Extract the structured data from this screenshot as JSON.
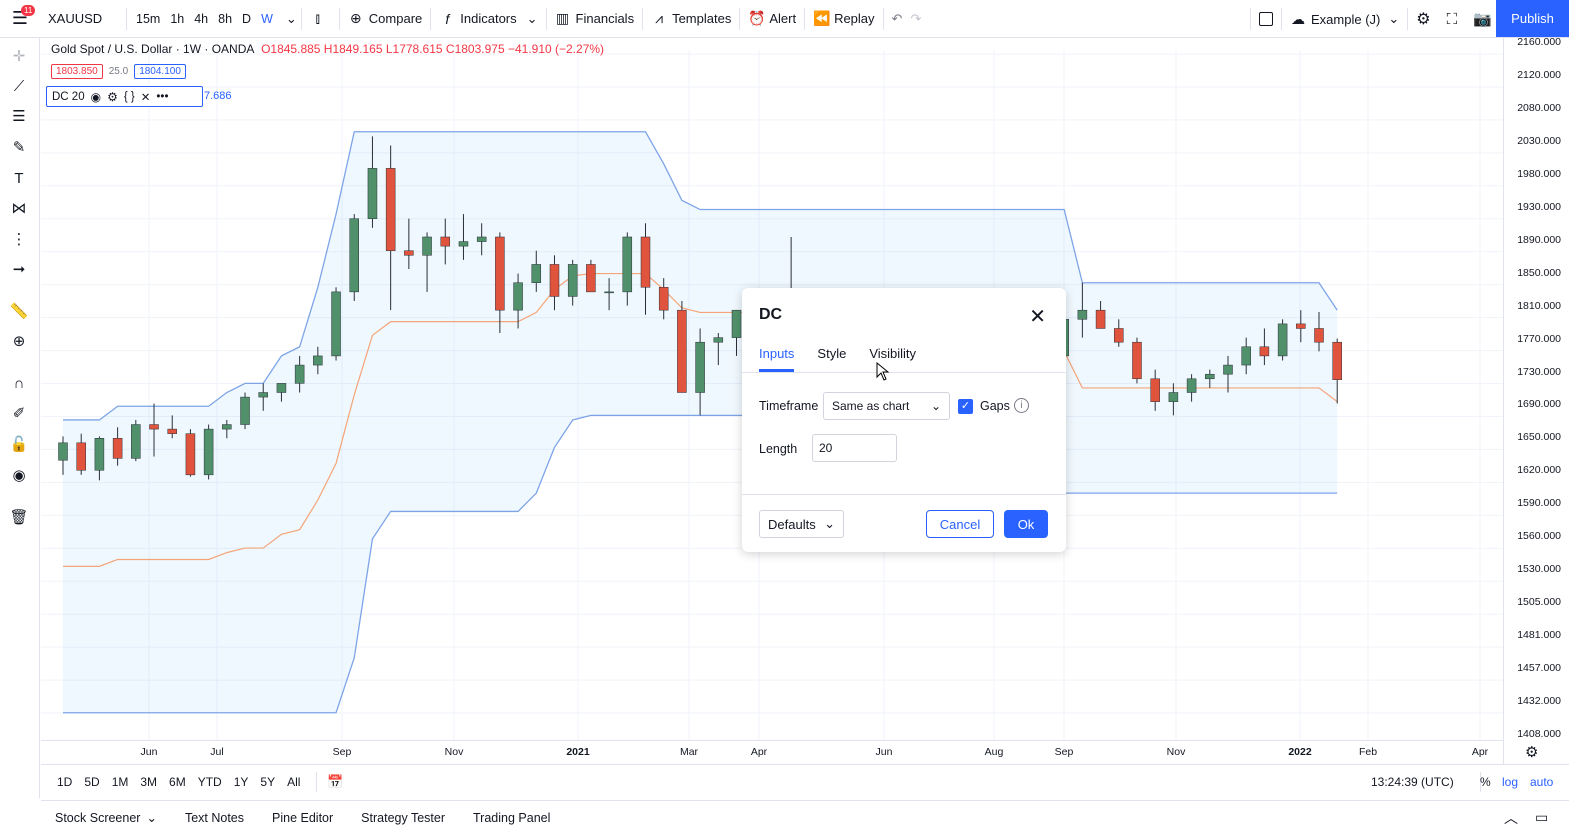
{
  "topbar": {
    "notification_count": "11",
    "symbol": "XAUUSD",
    "timeframes": [
      "15m",
      "1h",
      "4h",
      "8h",
      "D",
      "W"
    ],
    "active_timeframe": "W",
    "compare": "Compare",
    "indicators": "Indicators",
    "financials": "Financials",
    "templates": "Templates",
    "alert": "Alert",
    "replay": "Replay",
    "layout_name": "Example (J)",
    "publish": "Publish"
  },
  "legend": {
    "title": "Gold Spot / U.S. Dollar · 1W · OANDA",
    "ohlc": "O1845.885 H1849.165 L1778.615 C1803.975 −41.910 (−2.27%)",
    "sell_price": "1803.850",
    "spread": "25.0",
    "buy_price": "1804.100"
  },
  "indicator": {
    "name": "DC 20",
    "value": "7.686"
  },
  "chart_data": {
    "type": "candlestick",
    "symbol": "XAUUSD",
    "interval": "1W",
    "price_axis": [
      "2160.000",
      "2120.000",
      "2080.000",
      "2030.000",
      "1980.000",
      "1930.000",
      "1890.000",
      "1850.000",
      "1810.000",
      "1770.000",
      "1730.000",
      "1690.000",
      "1650.000",
      "1620.000",
      "1590.000",
      "1560.000",
      "1530.000",
      "1505.000",
      "1481.000",
      "1457.000",
      "1432.000",
      "1408.000"
    ],
    "date_axis": [
      {
        "label": "Jun",
        "year": false
      },
      {
        "label": "Jul",
        "year": false
      },
      {
        "label": "Sep",
        "year": false
      },
      {
        "label": "Nov",
        "year": false
      },
      {
        "label": "2021",
        "year": true
      },
      {
        "label": "Mar",
        "year": false
      },
      {
        "label": "Apr",
        "year": false
      },
      {
        "label": "Jun",
        "year": false
      },
      {
        "label": "Aug",
        "year": false
      },
      {
        "label": "Sep",
        "year": false
      },
      {
        "label": "Nov",
        "year": false
      },
      {
        "label": "2022",
        "year": true
      },
      {
        "label": "Feb",
        "year": false
      },
      {
        "label": "Apr",
        "year": false
      }
    ],
    "candles": [
      [
        1716,
        1742,
        1700,
        1735
      ],
      [
        1735,
        1745,
        1700,
        1705
      ],
      [
        1705,
        1742,
        1694,
        1740
      ],
      [
        1740,
        1752,
        1710,
        1718
      ],
      [
        1718,
        1760,
        1715,
        1755
      ],
      [
        1755,
        1778,
        1720,
        1750
      ],
      [
        1750,
        1765,
        1740,
        1745
      ],
      [
        1745,
        1750,
        1698,
        1700
      ],
      [
        1700,
        1755,
        1695,
        1750
      ],
      [
        1750,
        1760,
        1740,
        1755
      ],
      [
        1755,
        1790,
        1750,
        1785
      ],
      [
        1785,
        1800,
        1770,
        1790
      ],
      [
        1790,
        1800,
        1780,
        1800
      ],
      [
        1800,
        1830,
        1790,
        1820
      ],
      [
        1820,
        1840,
        1810,
        1830
      ],
      [
        1830,
        1905,
        1825,
        1900
      ],
      [
        1900,
        1985,
        1890,
        1980
      ],
      [
        1980,
        2070,
        1970,
        2035
      ],
      [
        2035,
        2060,
        1880,
        1945
      ],
      [
        1945,
        1980,
        1925,
        1940
      ],
      [
        1940,
        1965,
        1900,
        1960
      ],
      [
        1960,
        1980,
        1930,
        1950
      ],
      [
        1950,
        1985,
        1935,
        1955
      ],
      [
        1955,
        1975,
        1940,
        1960
      ],
      [
        1960,
        1965,
        1855,
        1880
      ],
      [
        1880,
        1920,
        1860,
        1910
      ],
      [
        1910,
        1945,
        1900,
        1930
      ],
      [
        1930,
        1940,
        1880,
        1895
      ],
      [
        1895,
        1935,
        1885,
        1930
      ],
      [
        1930,
        1935,
        1900,
        1900
      ],
      [
        1900,
        1915,
        1880,
        1900
      ],
      [
        1900,
        1965,
        1885,
        1960
      ],
      [
        1960,
        1975,
        1875,
        1905
      ],
      [
        1905,
        1915,
        1870,
        1880
      ],
      [
        1880,
        1890,
        1810,
        1790
      ],
      [
        1790,
        1860,
        1765,
        1845
      ],
      [
        1845,
        1855,
        1820,
        1850
      ],
      [
        1850,
        1880,
        1830,
        1880
      ],
      [
        1880,
        1890,
        1870,
        1875
      ],
      [
        1875,
        1895,
        1855,
        1890
      ],
      [
        1890,
        1960,
        1840,
        1840
      ],
      [
        1840,
        1855,
        1810,
        1825
      ],
      [
        1825,
        1860,
        1815,
        1855
      ],
      [
        1855,
        1875,
        1835,
        1845
      ],
      [
        1845,
        1850,
        1790,
        1830
      ],
      [
        1830,
        1850,
        1800,
        1835
      ],
      [
        1835,
        1840,
        1790,
        1795
      ],
      [
        1795,
        1810,
        1730,
        1730
      ],
      [
        1730,
        1760,
        1680,
        1700
      ],
      [
        1700,
        1740,
        1680,
        1730
      ],
      [
        1730,
        1760,
        1720,
        1755
      ],
      [
        1755,
        1760,
        1730,
        1740
      ],
      [
        1740,
        1760,
        1735,
        1755
      ],
      [
        1755,
        1790,
        1745,
        1785
      ],
      [
        1785,
        1835,
        1780,
        1830
      ],
      [
        1830,
        1880,
        1825,
        1870
      ],
      [
        1870,
        1910,
        1850,
        1880
      ],
      [
        1880,
        1890,
        1860,
        1860
      ],
      [
        1860,
        1870,
        1840,
        1845
      ],
      [
        1845,
        1850,
        1800,
        1805
      ],
      [
        1805,
        1815,
        1770,
        1780
      ],
      [
        1780,
        1800,
        1765,
        1790
      ],
      [
        1790,
        1810,
        1780,
        1805
      ],
      [
        1805,
        1815,
        1795,
        1810
      ],
      [
        1810,
        1830,
        1790,
        1820
      ],
      [
        1820,
        1850,
        1810,
        1840
      ],
      [
        1840,
        1860,
        1820,
        1830
      ],
      [
        1830,
        1870,
        1825,
        1865
      ],
      [
        1865,
        1880,
        1845,
        1860
      ],
      [
        1860,
        1878,
        1835,
        1845
      ],
      [
        1845,
        1849,
        1778,
        1804
      ]
    ],
    "donchian_upper": [
      1760,
      1760,
      1760,
      1775,
      1775,
      1775,
      1775,
      1775,
      1775,
      1790,
      1800,
      1800,
      1830,
      1840,
      1905,
      1985,
      2075,
      2075,
      2075,
      2075,
      2075,
      2075,
      2075,
      2075,
      2075,
      2075,
      2075,
      2075,
      2075,
      2075,
      2075,
      2075,
      2075,
      2040,
      2000,
      1990,
      1990,
      1990,
      1990,
      1990,
      1990,
      1990,
      1990,
      1990,
      1990,
      1990,
      1990,
      1990,
      1990,
      1990,
      1990,
      1990,
      1990,
      1990,
      1990,
      1990,
      1910,
      1910,
      1910,
      1910,
      1910,
      1910,
      1910,
      1910,
      1910,
      1910,
      1910,
      1910,
      1910,
      1910,
      1880
    ],
    "donchian_lower": [
      1440,
      1440,
      1440,
      1440,
      1440,
      1440,
      1440,
      1440,
      1440,
      1440,
      1440,
      1440,
      1440,
      1440,
      1440,
      1440,
      1500,
      1630,
      1660,
      1660,
      1660,
      1660,
      1660,
      1660,
      1660,
      1660,
      1680,
      1730,
      1760,
      1765,
      1765,
      1765,
      1765,
      1765,
      1765,
      1765,
      1765,
      1765,
      1765,
      1765,
      1765,
      1760,
      1740,
      1680,
      1680,
      1680,
      1680,
      1680,
      1680,
      1680,
      1680,
      1680,
      1680,
      1680,
      1680,
      1680,
      1680,
      1680,
      1680,
      1680,
      1680,
      1680,
      1680,
      1680,
      1680,
      1680,
      1680,
      1680,
      1680,
      1680,
      1680
    ]
  },
  "dialog": {
    "title": "DC",
    "tabs": [
      "Inputs",
      "Style",
      "Visibility"
    ],
    "active_tab": "Inputs",
    "timeframe_label": "Timeframe",
    "timeframe_value": "Same as chart",
    "gaps_label": "Gaps",
    "gaps_checked": true,
    "length_label": "Length",
    "length_value": "20",
    "defaults": "Defaults",
    "cancel": "Cancel",
    "ok": "Ok"
  },
  "bottom": {
    "ranges": [
      "1D",
      "5D",
      "1M",
      "3M",
      "6M",
      "YTD",
      "1Y",
      "5Y",
      "All"
    ],
    "time": "13:24:39 (UTC)",
    "percent": "%",
    "log": "log",
    "auto": "auto",
    "tabs": [
      "Stock Screener",
      "Text Notes",
      "Pine Editor",
      "Strategy Tester",
      "Trading Panel"
    ]
  }
}
